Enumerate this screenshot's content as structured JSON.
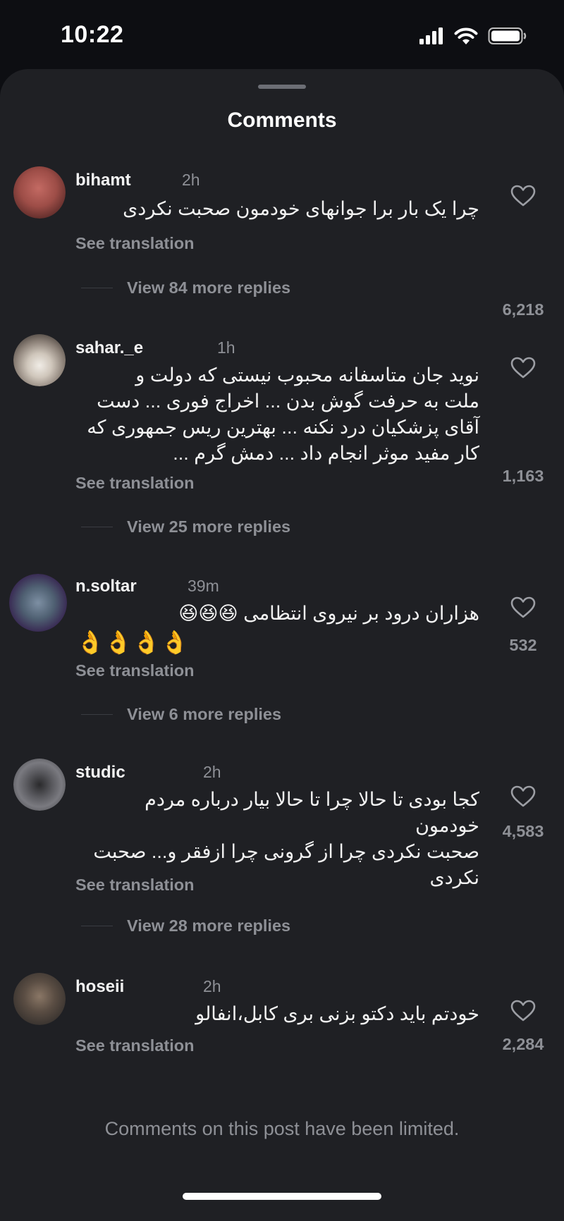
{
  "status": {
    "time": "10:22",
    "icons": [
      "cellular-icon",
      "wifi-icon",
      "battery-icon"
    ]
  },
  "sheet": {
    "title": "Comments"
  },
  "comments": [
    {
      "username": "bihamt",
      "time": "2h",
      "text": "چرا یک بار برا جوانهای خودمون صحبت نکردی",
      "see_translation": "See translation",
      "likes": "6,218",
      "view_replies": "View 84 more replies"
    },
    {
      "username": "sahar._e",
      "time": "1h",
      "text": "نوید جان  متاسفانه  محبوب نیستی که  دولت و\nملت به حرفت گوش بدن ... اخراج فوری ... دست\nآقای پزشکیان درد نکنه ... بهترین ریس جمهوری که\nکار مفید  موثر انجام داد ... دمش گرم ...",
      "see_translation": "See translation",
      "likes": "1,163",
      "view_replies": "View 25 more replies"
    },
    {
      "username": "n.soltar",
      "time": "39m",
      "text": "هزاران درود بر نیروی انتظامی 😆😆😆",
      "emoji_line": "👌👌👌👌",
      "see_translation": "See translation",
      "likes": "532",
      "view_replies": "View 6 more replies"
    },
    {
      "username": "studic",
      "time": "2h",
      "text": "کجا بودی تا حالا چرا تا حالا بیار درباره مردم خودمون\nصحبت نکردی چرا از گرونی چرا ازفقر و... صحبت\nنکردی",
      "see_translation": "See translation",
      "likes": "4,583",
      "view_replies": "View 28 more replies"
    },
    {
      "username": "hoseii",
      "time": "2h",
      "text": "خودتم باید دکتو بزنی بری کابل،انفالو",
      "see_translation": "See translation",
      "likes": "2,284"
    }
  ],
  "footer": {
    "limited_notice": "Comments on this post have been limited."
  },
  "colors": {
    "sheet_bg": "#1f2024",
    "page_bg": "#0d0e12",
    "muted_text": "#8e9096",
    "primary_text": "#f2f2f2"
  }
}
